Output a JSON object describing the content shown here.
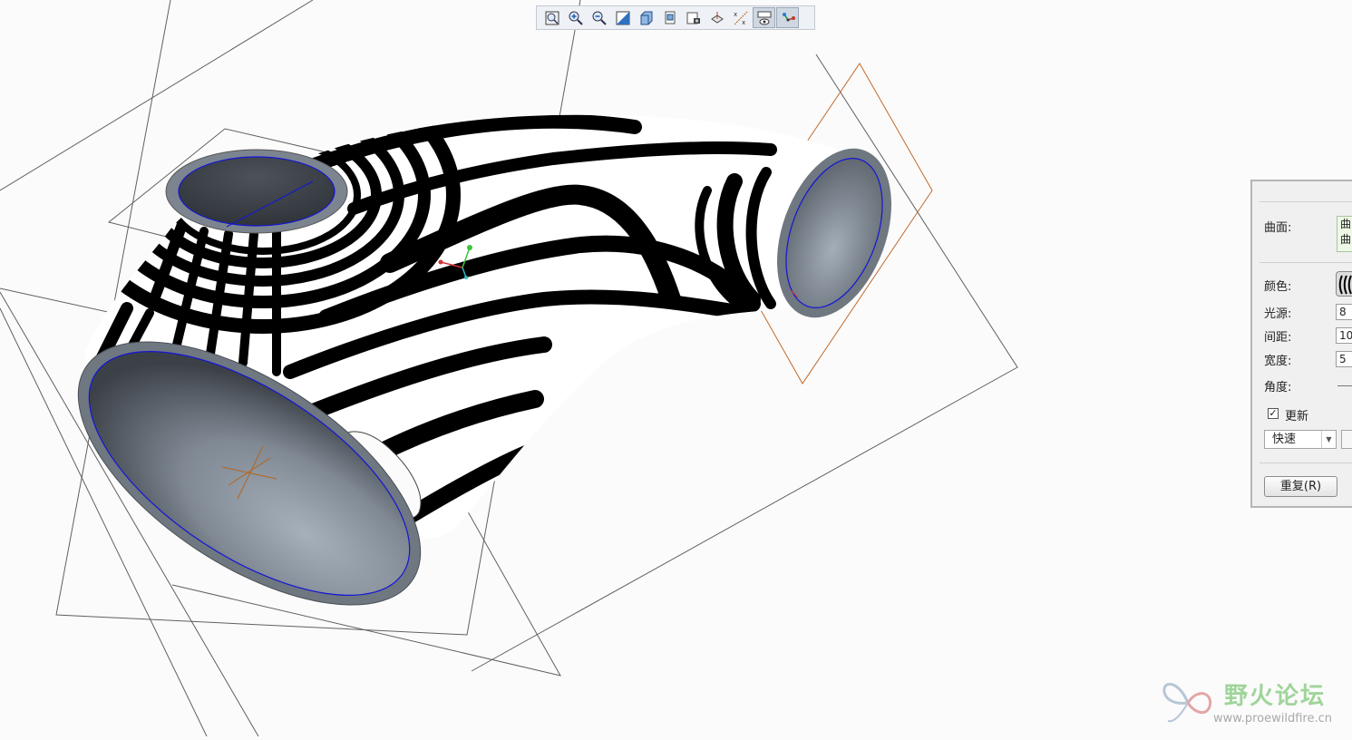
{
  "toolbar": {
    "buttons": [
      {
        "icon": "refit-icon"
      },
      {
        "icon": "zoom-in-icon"
      },
      {
        "icon": "zoom-out-icon"
      },
      {
        "icon": "repaint-icon"
      },
      {
        "icon": "shaded-display-icon"
      },
      {
        "icon": "saved-orientations-icon"
      },
      {
        "icon": "view-manager-icon"
      },
      {
        "icon": "datum-planes-icon"
      },
      {
        "icon": "datum-axes-points-icon"
      },
      {
        "icon": "annotation-display-icon",
        "active": true
      },
      {
        "icon": "spin-center-icon",
        "active": true
      }
    ]
  },
  "panel": {
    "surface_label": "曲面:",
    "surface_values": [
      "曲",
      "曲"
    ],
    "color_label": "颜色:",
    "light_label": "光源:",
    "light_value": "8",
    "spacing_label": "间距:",
    "spacing_value": "10",
    "width_label": "宽度:",
    "width_value": "5",
    "angle_label": "角度:",
    "update_label": "更新",
    "update_checked": true,
    "quality_value": "快速",
    "repeat_button": "重复(R)"
  },
  "watermark": {
    "title": "野火论坛",
    "url": "www.proewildfire.cn"
  },
  "colors": {
    "background": "#fbfbfb",
    "pipe_edge": "#1515d6",
    "datum_plane": "#555555",
    "selected_plane": "#c26a2e",
    "pipe_interior": "#8d96a2"
  }
}
